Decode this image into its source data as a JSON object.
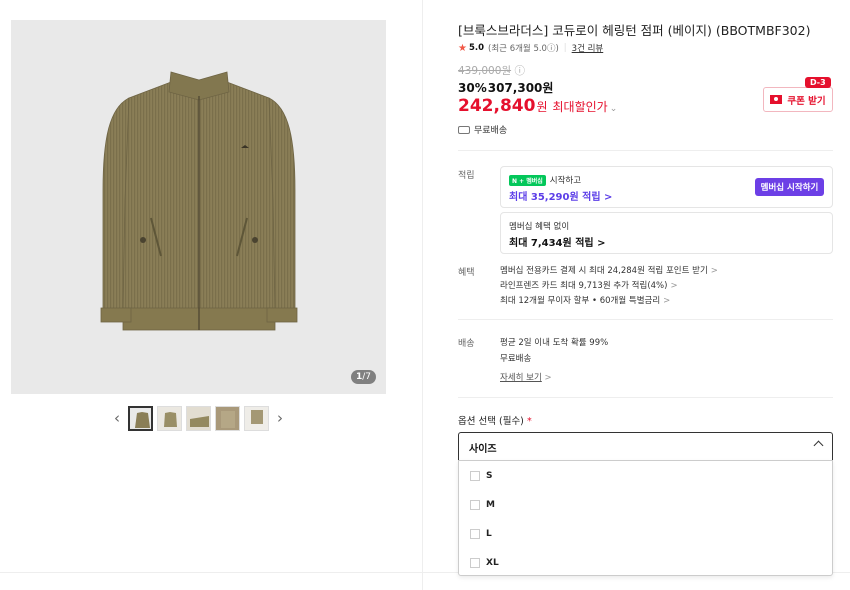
{
  "product": {
    "title": "[브룩스브라더스] 코듀로이 헤링턴 점퍼 (베이지) (BBOTMBF302)",
    "image_counter_current": "1",
    "image_counter_total": "/7"
  },
  "rating": {
    "score": "5.0",
    "recent": "(최근 6개월 5.0ⓘ)",
    "reviews": "3건 리뷰"
  },
  "price": {
    "original": "439,000원",
    "original_info_icon": "ⓘ",
    "discount_pct": "30%",
    "discounted": "307,300원",
    "final": "242,840",
    "final_unit": "원",
    "max_discount_label": "최대할인가",
    "max_discount_chev": "⌄"
  },
  "coupon": {
    "label": "쿠폰 받기",
    "badge": "D-3",
    "color": "#e5102d"
  },
  "shipping_free": "무료배송",
  "points": {
    "section_label": "적립",
    "membership_badge": "N + 멤버십",
    "membership_line": "시작하고",
    "membership_max": "최대 35,290원 적립 >",
    "membership_button": "멤버십 시작하기",
    "membership_color": "#6c3fe6",
    "no_membership_line": "멤버십 혜택 없이",
    "no_membership_max": "최대 7,434원 적립 >"
  },
  "benefits": {
    "section_label": "혜택",
    "items": [
      "멤버십 전용카드 결제 시 최대 24,284원 적립 포인트 받기",
      "라인프렌즈 카드 최대 9,713원 추가 적립(4%)",
      "최대 12개월 무이자 할부 • 60개월 특별금리"
    ],
    "chevron": ">"
  },
  "delivery": {
    "section_label": "배송",
    "line1": "평균 2일 이내 도착 확률 99%",
    "line2": "무료배송",
    "details_link": "자세히 보기",
    "details_chev": ">"
  },
  "options": {
    "label": "옵션 선택 (필수)",
    "required_mark": "*",
    "select_value": "사이즈",
    "items": [
      "S",
      "M",
      "L",
      "XL"
    ]
  },
  "icons": {
    "star": "★",
    "thumb_prev": "‹",
    "thumb_next": "›"
  }
}
